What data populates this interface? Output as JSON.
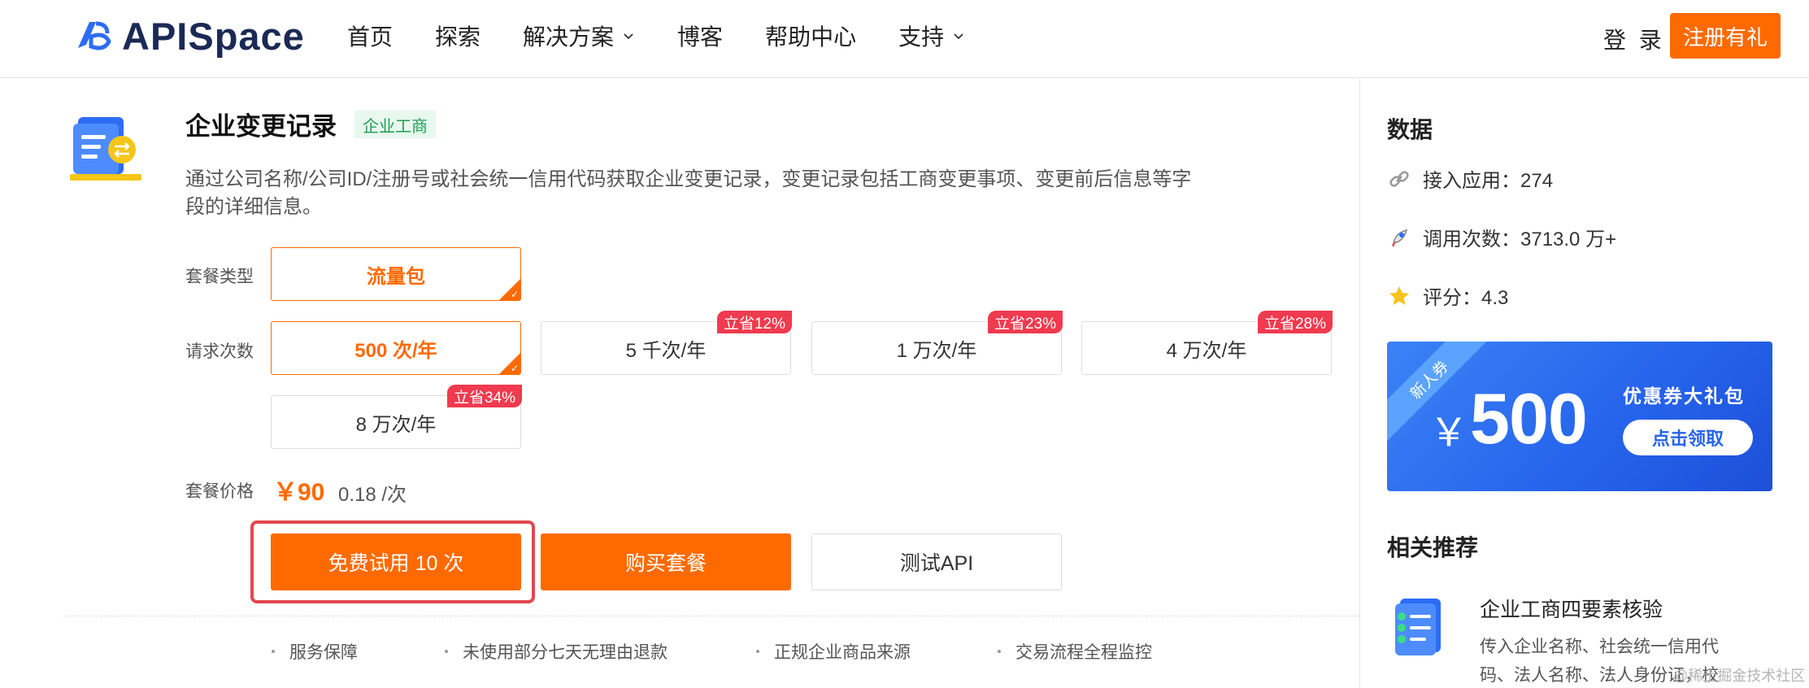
{
  "header": {
    "logo_text": "APISpace",
    "nav": [
      {
        "label": "首页",
        "has_dropdown": false
      },
      {
        "label": "探索",
        "has_dropdown": false
      },
      {
        "label": "解决方案",
        "has_dropdown": true
      },
      {
        "label": "博客",
        "has_dropdown": false
      },
      {
        "label": "帮助中心",
        "has_dropdown": false
      },
      {
        "label": "支持",
        "has_dropdown": true
      }
    ],
    "login_label": "登 录",
    "register_label": "注册有礼"
  },
  "product": {
    "title": "企业变更记录",
    "tag": "企业工商",
    "description": "通过公司名称/公司ID/注册号或社会统一信用代码获取企业变更记录，变更记录包括工商变更事项、变更前后信息等字段的详细信息。",
    "package_type_label": "套餐类型",
    "package_types": [
      {
        "label": "流量包",
        "selected": true
      }
    ],
    "request_count_label": "请求次数",
    "request_options": [
      {
        "label": "500 次/年",
        "selected": true,
        "badge": ""
      },
      {
        "label": "5 千次/年",
        "selected": false,
        "badge": "立省12%"
      },
      {
        "label": "1 万次/年",
        "selected": false,
        "badge": "立省23%"
      },
      {
        "label": "4 万次/年",
        "selected": false,
        "badge": "立省28%"
      },
      {
        "label": "8 万次/年",
        "selected": false,
        "badge": "立省34%"
      }
    ],
    "price_label": "套餐价格",
    "price": "￥90",
    "unit_price": "0.18 /次",
    "buttons": {
      "trial": "免费试用 10 次",
      "buy": "购买套餐",
      "test": "测试API"
    },
    "guarantees": [
      "服务保障",
      "未使用部分七天无理由退款",
      "正规企业商品来源",
      "交易流程全程监控"
    ]
  },
  "sidebar": {
    "data_title": "数据",
    "stats": [
      {
        "icon": "link-icon",
        "text": "接入应用：274"
      },
      {
        "icon": "rocket-icon",
        "text": "调用次数：3713.0 万+"
      },
      {
        "icon": "star-icon",
        "text": "评分：4.3"
      }
    ],
    "coupon": {
      "ribbon": "新人券",
      "currency": "￥",
      "amount": "500",
      "title": "优惠券大礼包",
      "button": "点击领取"
    },
    "related_title": "相关推荐",
    "related": [
      {
        "title": "企业工商四要素核验",
        "description": "传入企业名称、社会统一信用代码、法人名称、法人身份证，校"
      }
    ]
  },
  "watermark": "@稀土掘金技术社区",
  "colors": {
    "accent": "#ff6a00",
    "badge": "#f03a4f",
    "tag_green": "#1f9d55",
    "coupon_blue": "#2563eb",
    "highlight": "#e2474f"
  }
}
